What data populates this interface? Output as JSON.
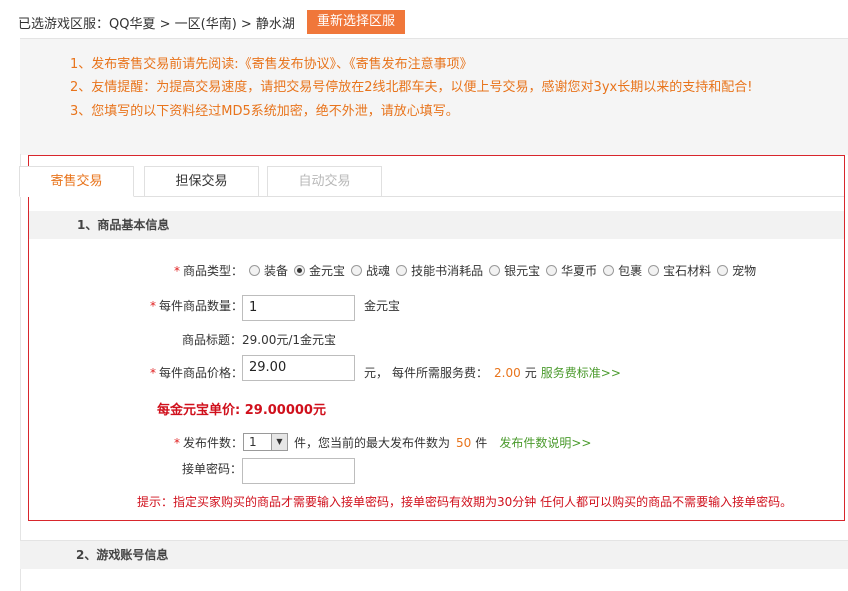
{
  "breadcrumb": {
    "text": "已选游戏区服：QQ华夏 > 一区(华南) > 静水湖",
    "button": "重新选择区服"
  },
  "notice": [
    "1、发布寄售交易前请先阅读:《寄售发布协议》、《寄售发布注意事项》",
    "2、友情提醒：为提高交易速度，请把交易号停放在2线北郡车夫，以便上号交易，感谢您对3yx长期以来的支持和配合!",
    "3、您填写的以下资料经过MD5系统加密，绝不外泄，请放心填写。"
  ],
  "tabs": [
    {
      "label": "寄售交易",
      "state": "active"
    },
    {
      "label": "担保交易",
      "state": "normal"
    },
    {
      "label": "自动交易",
      "state": "disabled"
    }
  ],
  "section1": {
    "title": "1、商品基本信息"
  },
  "form": {
    "type_label": "商品类型：",
    "types": [
      "装备",
      "金元宝",
      "战魂",
      "技能书消耗品",
      "银元宝",
      "华夏币",
      "包裹",
      "宝石材料",
      "宠物"
    ],
    "type_selected": 1,
    "qty_label": "每件商品数量：",
    "qty_value": "1",
    "qty_unit": "金元宝",
    "title_label": "商品标题：",
    "title_value": "29.00元/1金元宝",
    "price_label": "每件商品价格：",
    "price_value": "29.00",
    "price_unit": "元，",
    "fee_label": "每件所需服务费：",
    "fee_value": "2.00",
    "fee_unit": "元",
    "fee_link": "服务费标准>>",
    "unit_price": "每金元宝单价: 29.00000元",
    "count_label": "发布件数：",
    "count_value": "1",
    "count_text": "件，您当前的最大发布件数为",
    "count_max": "50",
    "count_unit": "件",
    "count_link": "发布件数说明>>",
    "pwd_label": "接单密码：",
    "hint": "提示：指定买家购买的商品才需要输入接单密码，接单密码有效期为30分钟 任何人都可以购买的商品不需要输入接单密码。"
  },
  "section2": {
    "title": "2、游戏账号信息"
  },
  "colors": {
    "accent": "#f0773a",
    "frame": "#d8262c",
    "link": "#4a9a2c"
  }
}
